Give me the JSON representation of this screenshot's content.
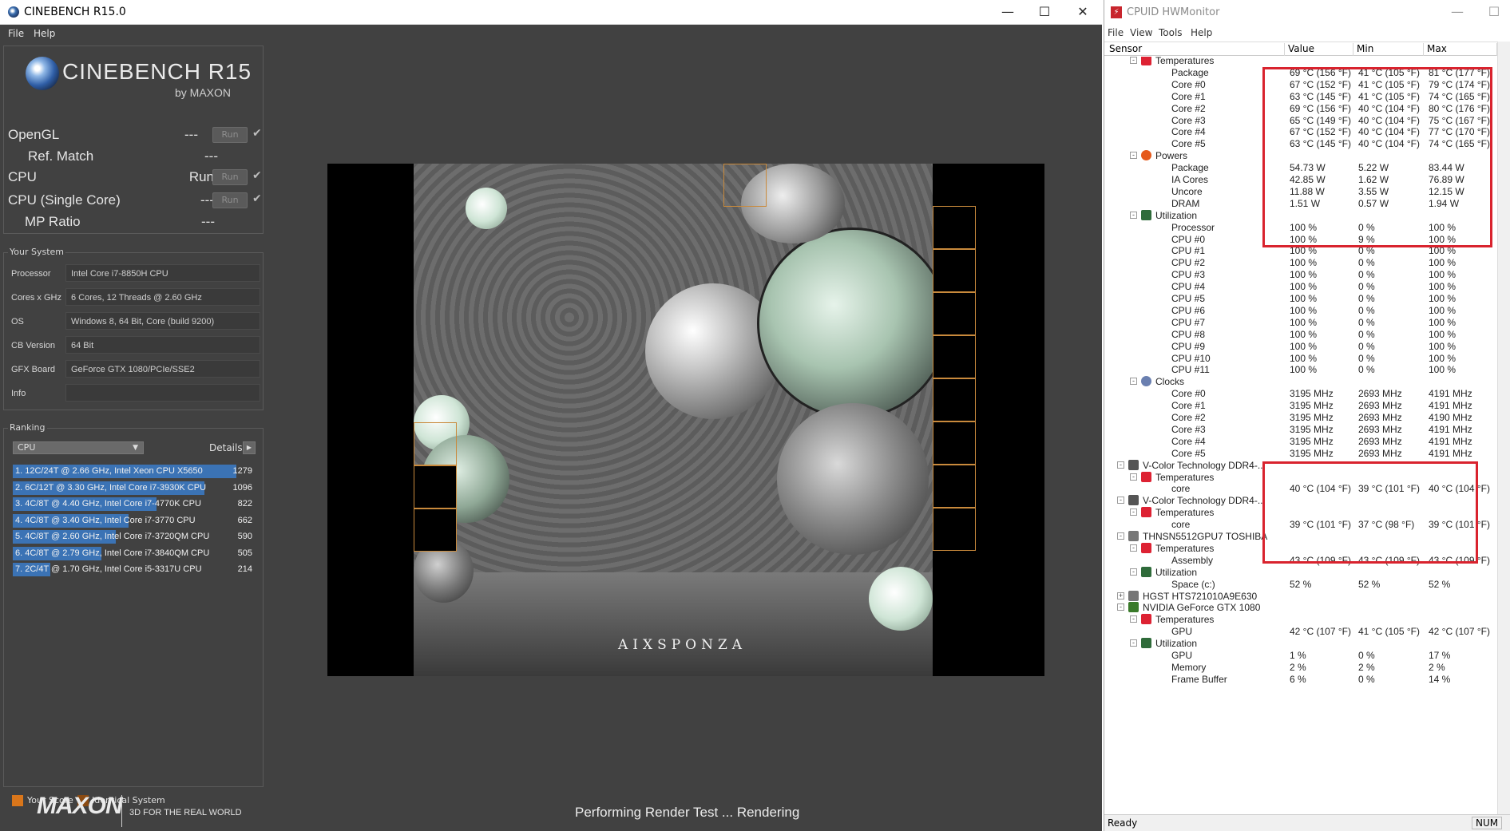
{
  "cinebench": {
    "title": "CINEBENCH R15.0",
    "menu": [
      "File",
      "Help"
    ],
    "logo_name": "CINEBENCH R15",
    "logo_by": "by MAXON",
    "benchmarks": [
      {
        "label": "OpenGL",
        "value": "---",
        "run": "Run",
        "check": "✔"
      },
      {
        "label": "Ref. Match",
        "value": "---"
      },
      {
        "label": "CPU",
        "value": "Run",
        "run": "Run",
        "check": "✔"
      },
      {
        "label": "CPU (Single Core)",
        "value": "---",
        "run": "Run",
        "check": "✔"
      },
      {
        "label": "MP Ratio",
        "value": "---"
      }
    ],
    "your_system_title": "Your System",
    "system": [
      {
        "key": "Processor",
        "value": "Intel Core i7-8850H CPU"
      },
      {
        "key": "Cores x GHz",
        "value": "6 Cores, 12 Threads @ 2.60 GHz"
      },
      {
        "key": "OS",
        "value": "Windows 8, 64 Bit, Core (build 9200)"
      },
      {
        "key": "CB Version",
        "value": "64 Bit"
      },
      {
        "key": "GFX Board",
        "value": "GeForce GTX 1080/PCIe/SSE2"
      },
      {
        "key": "Info",
        "value": ""
      }
    ],
    "ranking_title": "Ranking",
    "ranking_select": "CPU",
    "details_label": "Details",
    "ranking": [
      {
        "label": "1. 12C/24T @ 2.66 GHz, Intel Xeon CPU X5650",
        "score": "1279",
        "frac": 1.0
      },
      {
        "label": "2. 6C/12T @ 3.30 GHz,  Intel Core i7-3930K CPU",
        "score": "1096",
        "frac": 0.857
      },
      {
        "label": "3. 4C/8T @ 4.40 GHz, Intel Core i7-4770K CPU",
        "score": "822",
        "frac": 0.643
      },
      {
        "label": "4. 4C/8T @ 3.40 GHz,  Intel Core i7-3770 CPU",
        "score": "662",
        "frac": 0.518
      },
      {
        "label": "5. 4C/8T @ 2.60 GHz, Intel Core i7-3720QM CPU",
        "score": "590",
        "frac": 0.461
      },
      {
        "label": "6. 4C/8T @ 2.79 GHz,  Intel Core i7-3840QM CPU",
        "score": "505",
        "frac": 0.395
      },
      {
        "label": "7. 2C/4T @ 1.70 GHz,  Intel Core i5-3317U CPU",
        "score": "214",
        "frac": 0.167
      }
    ],
    "legend_your_score": "Your Score",
    "legend_identical": "Identical System",
    "colors": {
      "bar": "#3b73b5",
      "your_score": "#d9761b",
      "identical": "#8a4a12"
    },
    "maxon_logo": "MAXON",
    "maxon_tagline": "3D FOR THE REAL WORLD",
    "status": "Performing Render Test ... Rendering",
    "render_brand": "AIXSPONZA"
  },
  "hwmonitor": {
    "title": "CPUID HWMonitor",
    "menu": [
      "File",
      "View",
      "Tools",
      "Help"
    ],
    "columns": [
      "Sensor",
      "Value",
      "Min",
      "Max"
    ],
    "rows": [
      {
        "indent": 2,
        "icon": "temp-icon",
        "name": "Temperatures",
        "exp": "-"
      },
      {
        "indent": 3,
        "name": "Package",
        "v": "69 °C  (156 °F)",
        "mn": "41 °C  (105 °F)",
        "mx": "81 °C  (177 °F)"
      },
      {
        "indent": 3,
        "name": "Core #0",
        "v": "67 °C  (152 °F)",
        "mn": "41 °C  (105 °F)",
        "mx": "79 °C  (174 °F)"
      },
      {
        "indent": 3,
        "name": "Core #1",
        "v": "63 °C  (145 °F)",
        "mn": "41 °C  (105 °F)",
        "mx": "74 °C  (165 °F)"
      },
      {
        "indent": 3,
        "name": "Core #2",
        "v": "69 °C  (156 °F)",
        "mn": "40 °C  (104 °F)",
        "mx": "80 °C  (176 °F)"
      },
      {
        "indent": 3,
        "name": "Core #3",
        "v": "65 °C  (149 °F)",
        "mn": "40 °C  (104 °F)",
        "mx": "75 °C  (167 °F)"
      },
      {
        "indent": 3,
        "name": "Core #4",
        "v": "67 °C  (152 °F)",
        "mn": "40 °C  (104 °F)",
        "mx": "77 °C  (170 °F)"
      },
      {
        "indent": 3,
        "name": "Core #5",
        "v": "63 °C  (145 °F)",
        "mn": "40 °C  (104 °F)",
        "mx": "74 °C  (165 °F)"
      },
      {
        "indent": 2,
        "icon": "power-icon",
        "name": "Powers",
        "exp": "-"
      },
      {
        "indent": 3,
        "name": "Package",
        "v": "54.73 W",
        "mn": "5.22 W",
        "mx": "83.44 W"
      },
      {
        "indent": 3,
        "name": "IA Cores",
        "v": "42.85 W",
        "mn": "1.62 W",
        "mx": "76.89 W"
      },
      {
        "indent": 3,
        "name": "Uncore",
        "v": "11.88 W",
        "mn": "3.55 W",
        "mx": "12.15 W"
      },
      {
        "indent": 3,
        "name": "DRAM",
        "v": "1.51 W",
        "mn": "0.57 W",
        "mx": "1.94 W"
      },
      {
        "indent": 2,
        "icon": "util-icon",
        "name": "Utilization",
        "exp": "-"
      },
      {
        "indent": 3,
        "name": "Processor",
        "v": "100 %",
        "mn": "0 %",
        "mx": "100 %"
      },
      {
        "indent": 3,
        "name": "CPU #0",
        "v": "100 %",
        "mn": "9 %",
        "mx": "100 %"
      },
      {
        "indent": 3,
        "name": "CPU #1",
        "v": "100 %",
        "mn": "0 %",
        "mx": "100 %"
      },
      {
        "indent": 3,
        "name": "CPU #2",
        "v": "100 %",
        "mn": "0 %",
        "mx": "100 %"
      },
      {
        "indent": 3,
        "name": "CPU #3",
        "v": "100 %",
        "mn": "0 %",
        "mx": "100 %"
      },
      {
        "indent": 3,
        "name": "CPU #4",
        "v": "100 %",
        "mn": "0 %",
        "mx": "100 %"
      },
      {
        "indent": 3,
        "name": "CPU #5",
        "v": "100 %",
        "mn": "0 %",
        "mx": "100 %"
      },
      {
        "indent": 3,
        "name": "CPU #6",
        "v": "100 %",
        "mn": "0 %",
        "mx": "100 %"
      },
      {
        "indent": 3,
        "name": "CPU #7",
        "v": "100 %",
        "mn": "0 %",
        "mx": "100 %"
      },
      {
        "indent": 3,
        "name": "CPU #8",
        "v": "100 %",
        "mn": "0 %",
        "mx": "100 %"
      },
      {
        "indent": 3,
        "name": "CPU #9",
        "v": "100 %",
        "mn": "0 %",
        "mx": "100 %"
      },
      {
        "indent": 3,
        "name": "CPU #10",
        "v": "100 %",
        "mn": "0 %",
        "mx": "100 %"
      },
      {
        "indent": 3,
        "name": "CPU #11",
        "v": "100 %",
        "mn": "0 %",
        "mx": "100 %"
      },
      {
        "indent": 2,
        "icon": "clock-icon",
        "name": "Clocks",
        "exp": "-"
      },
      {
        "indent": 3,
        "name": "Core #0",
        "v": "3195 MHz",
        "mn": "2693 MHz",
        "mx": "4191 MHz"
      },
      {
        "indent": 3,
        "name": "Core #1",
        "v": "3195 MHz",
        "mn": "2693 MHz",
        "mx": "4191 MHz"
      },
      {
        "indent": 3,
        "name": "Core #2",
        "v": "3195 MHz",
        "mn": "2693 MHz",
        "mx": "4190 MHz"
      },
      {
        "indent": 3,
        "name": "Core #3",
        "v": "3195 MHz",
        "mn": "2693 MHz",
        "mx": "4191 MHz"
      },
      {
        "indent": 3,
        "name": "Core #4",
        "v": "3195 MHz",
        "mn": "2693 MHz",
        "mx": "4191 MHz"
      },
      {
        "indent": 3,
        "name": "Core #5",
        "v": "3195 MHz",
        "mn": "2693 MHz",
        "mx": "4191 MHz"
      },
      {
        "indent": 1,
        "icon": "ram-icon",
        "name": "V-Color Technology DDR4-...",
        "exp": "-"
      },
      {
        "indent": 2,
        "icon": "temp-icon",
        "name": "Temperatures",
        "exp": "-"
      },
      {
        "indent": 3,
        "name": "core",
        "v": "40 °C  (104 °F)",
        "mn": "39 °C  (101 °F)",
        "mx": "40 °C  (104 °F)"
      },
      {
        "indent": 1,
        "icon": "ram-icon",
        "name": "V-Color Technology DDR4-...",
        "exp": "-"
      },
      {
        "indent": 2,
        "icon": "temp-icon",
        "name": "Temperatures",
        "exp": "-"
      },
      {
        "indent": 3,
        "name": "core",
        "v": "39 °C  (101 °F)",
        "mn": "37 °C  (98 °F)",
        "mx": "39 °C  (101 °F)"
      },
      {
        "indent": 1,
        "icon": "disk-icon",
        "name": "THNSN5512GPU7 TOSHIBA",
        "exp": "-"
      },
      {
        "indent": 2,
        "icon": "temp-icon",
        "name": "Temperatures",
        "exp": "-"
      },
      {
        "indent": 3,
        "name": "Assembly",
        "v": "43 °C  (109 °F)",
        "mn": "43 °C  (109 °F)",
        "mx": "43 °C  (109 °F)"
      },
      {
        "indent": 2,
        "icon": "util-icon",
        "name": "Utilization",
        "exp": "-"
      },
      {
        "indent": 3,
        "name": "Space (c:)",
        "v": "52 %",
        "mn": "52 %",
        "mx": "52 %"
      },
      {
        "indent": 1,
        "icon": "disk-icon",
        "name": "HGST HTS721010A9E630",
        "exp": "+"
      },
      {
        "indent": 1,
        "icon": "gpu-icon",
        "name": "NVIDIA GeForce GTX 1080",
        "exp": "-"
      },
      {
        "indent": 2,
        "icon": "temp-icon",
        "name": "Temperatures",
        "exp": "-"
      },
      {
        "indent": 3,
        "name": "GPU",
        "v": "42 °C  (107 °F)",
        "mn": "41 °C  (105 °F)",
        "mx": "42 °C  (107 °F)"
      },
      {
        "indent": 2,
        "icon": "util-icon",
        "name": "Utilization",
        "exp": "-"
      },
      {
        "indent": 3,
        "name": "GPU",
        "v": "1 %",
        "mn": "0 %",
        "mx": "17 %"
      },
      {
        "indent": 3,
        "name": "Memory",
        "v": "2 %",
        "mn": "2 %",
        "mx": "2 %"
      },
      {
        "indent": 3,
        "name": "Frame Buffer",
        "v": "6 %",
        "mn": "0 %",
        "mx": "14 %"
      }
    ],
    "status_ready": "Ready",
    "status_num": "NUM"
  }
}
